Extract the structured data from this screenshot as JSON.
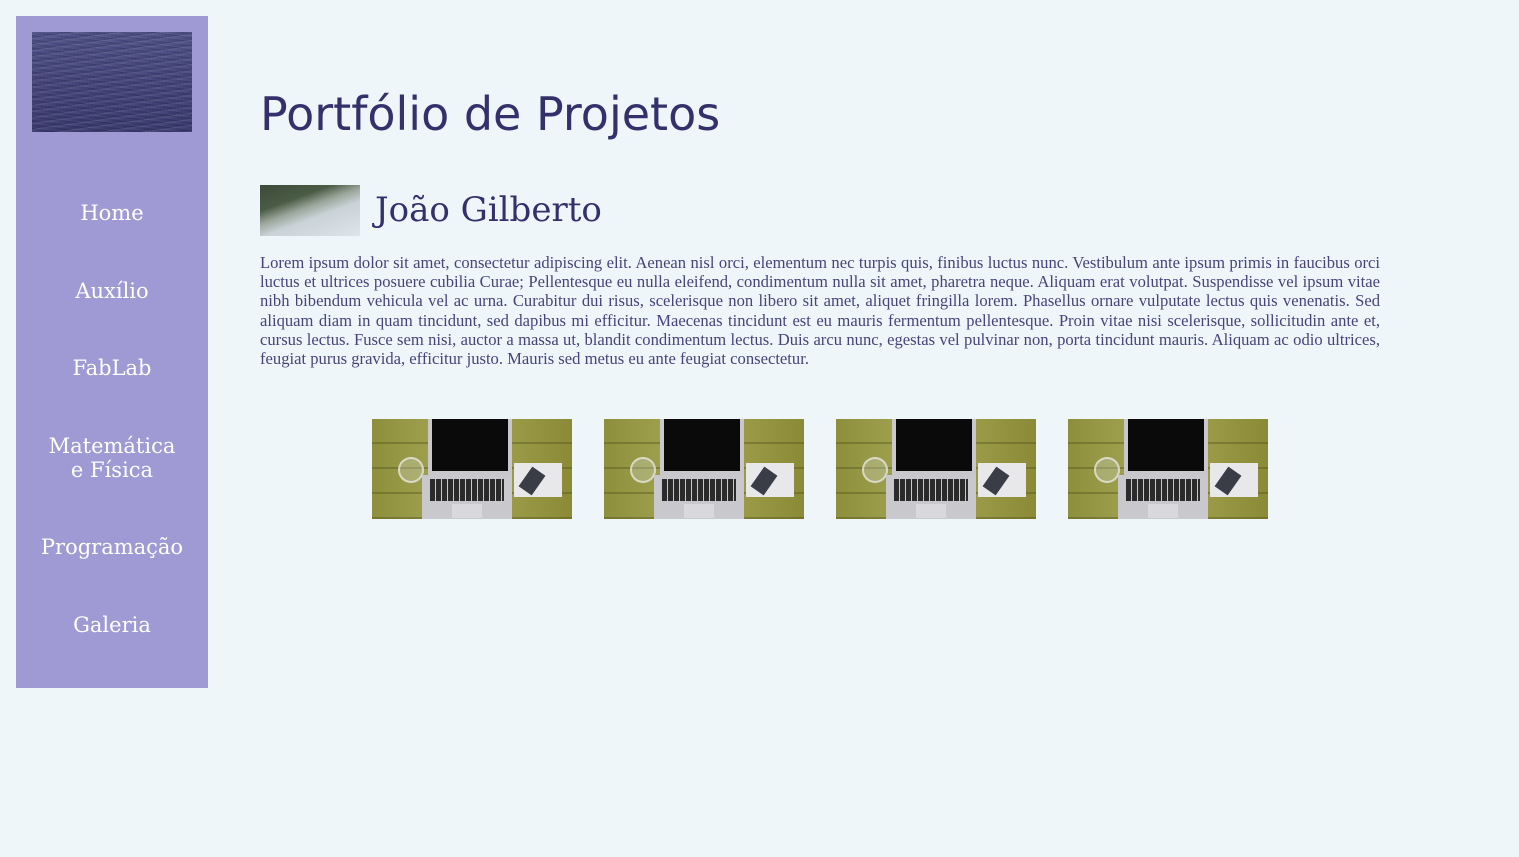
{
  "sidebar": {
    "logo_alt": "Imagem do mar",
    "items": [
      {
        "label": "Home"
      },
      {
        "label": "Auxílio"
      },
      {
        "label": "FabLab"
      },
      {
        "label": "Matemática e Física"
      },
      {
        "label": "Programação"
      },
      {
        "label": "Galeria"
      }
    ]
  },
  "main": {
    "title": "Portfólio de Projetos",
    "profile": {
      "name": "João Gilberto",
      "bio": "Lorem ipsum dolor sit amet, consectetur adipiscing elit. Aenean nisl orci, elementum nec turpis quis, finibus luctus nunc. Vestibulum ante ipsum primis in faucibus orci luctus et ultrices posuere cubilia Curae; Pellentesque eu nulla eleifend, condimentum nulla sit amet, pharetra neque. Aliquam erat volutpat. Suspendisse vel ipsum vitae nibh bibendum vehicula vel ac urna. Curabitur dui risus, scelerisque non libero sit amet, aliquet fringilla lorem. Phasellus ornare vulputate lectus quis venenatis. Sed aliquam diam in quam tincidunt, sed dapibus mi efficitur. Maecenas tincidunt est eu mauris fermentum pellentesque. Proin vitae nisi scelerisque, sollicitudin ante et, cursus lectus. Fusce sem nisi, auctor a massa ut, blandit condimentum lectus. Duis arcu nunc, egestas vel pulvinar non, porta tincidunt mauris. Aliquam ac odio ultrices, feugiat purus gravida, efficitur justo. Mauris sed metus eu ante feugiat consectetur."
    },
    "gallery_count": 4
  },
  "colors": {
    "background": "#eef6f9",
    "sidebar": "#9f9ad3",
    "heading": "#33306b",
    "body_text": "#47447b"
  }
}
